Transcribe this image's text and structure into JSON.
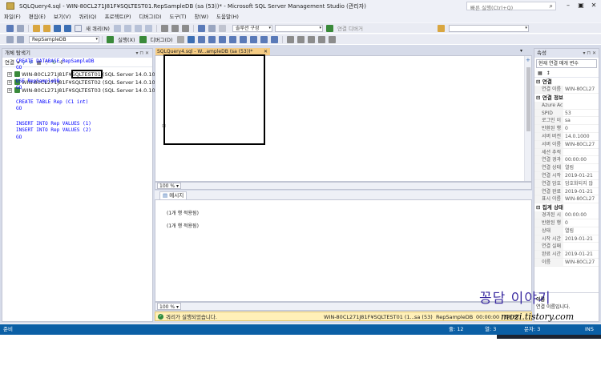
{
  "window": {
    "title": "SQLQuery4.sql - WIN-80CL271J81F¥SQLTEST01.RepSampleDB (sa (53))* - Microsoft SQL Server Management Studio (관리자)",
    "quick_launch_placeholder": "빠른 실행(Ctrl+Q)",
    "minimize": "–",
    "maximize": "▣",
    "close": "✕"
  },
  "menu": [
    "파일(F)",
    "편집(E)",
    "보기(V)",
    "쿼리(Q)",
    "프로젝트(P)",
    "디버그(D)",
    "도구(T)",
    "창(W)",
    "도움말(H)"
  ],
  "toolbar1": {
    "new_query": "새 쿼리(N)",
    "solution_configs": "솔루션 구성",
    "solution_platforms": "",
    "start_debug": "연결 디버거"
  },
  "toolbar2": {
    "database": "RepSampleDB",
    "execute": "실행(X)",
    "debug": "디버그(D)"
  },
  "object_explorer": {
    "title": "개체 탐색기",
    "connect": "연결",
    "servers": [
      {
        "name": "WIN-80CL271J81F¥SQLTEST01 (SQL Server 14.0.1000"
      },
      {
        "name": "WIN-80CL271J81F¥SQLTEST02 (SQL Server 14.0.1000"
      },
      {
        "name": "WIN-80CL271J81F¥SQLTEST03 (SQL Server 14.0.1000"
      }
    ]
  },
  "document": {
    "tab_label": "SQLQuery4.sql - W...ampleDB (sa (53))*",
    "code_lines": [
      "CREATE DATABASE RepSampleDB",
      "GO",
      "",
      "USE RepSampleDB",
      "GO",
      "",
      "CREATE TABLE Rep (C1 int)",
      "GO",
      "",
      "INSERT INTO Rep VALUES (1)",
      "INSERT INTO Rep VALUES (2)",
      "GO"
    ],
    "zoom": "100 %"
  },
  "results": {
    "tab_label": "메시지",
    "messages": [
      "(1개 행 적용됨)",
      "(1개 행 적용됨)"
    ],
    "zoom": "100 %"
  },
  "query_status": {
    "message": "쿼리가 실행되었습니다.",
    "server": "WIN-80CL271J81F¥SQLTEST01 (1...",
    "user": "sa (53)",
    "database": "RepSampleDB",
    "elapsed": "00:00:00",
    "rows": "0개 행"
  },
  "properties": {
    "title": "속성",
    "selector": "현재 연결 매개 변수",
    "groups": [
      {
        "name": "연결",
        "rows": [
          {
            "k": "연결 이름",
            "v": "WIN-80CL27"
          }
        ]
      },
      {
        "name": "연결 정보",
        "rows": [
          {
            "k": "Azure Ac",
            "v": ""
          },
          {
            "k": "SPID",
            "v": "53"
          },
          {
            "k": "로그인 이",
            "v": "sa"
          },
          {
            "k": "반환된 행",
            "v": "0"
          },
          {
            "k": "서버 버전",
            "v": "14.0.1000"
          },
          {
            "k": "서버 이름",
            "v": "WIN-80CL27"
          },
          {
            "k": "세션 추적",
            "v": ""
          },
          {
            "k": "연결 경과",
            "v": "00:00:00"
          },
          {
            "k": "연결 상태",
            "v": "열림"
          },
          {
            "k": "연결 시작",
            "v": "2019-01-21"
          },
          {
            "k": "연결 암호",
            "v": "암호화되지 않"
          },
          {
            "k": "연결 완료",
            "v": "2019-01-21"
          },
          {
            "k": "표시 이름",
            "v": "WIN-80CL27"
          }
        ]
      },
      {
        "name": "집계 상태",
        "rows": [
          {
            "k": "경과된 시",
            "v": "00:00:00"
          },
          {
            "k": "반환된 행",
            "v": "0"
          },
          {
            "k": "상태",
            "v": "열림"
          },
          {
            "k": "시작 시간",
            "v": "2019-01-21"
          },
          {
            "k": "연결 실패",
            "v": ""
          },
          {
            "k": "완료 시간",
            "v": "2019-01-21"
          },
          {
            "k": "이름",
            "v": "WIN-80CL27"
          }
        ]
      }
    ],
    "desc_title": "이름",
    "desc_text": "연결 이름입니다."
  },
  "watermark": {
    "title": "꽁담 이야기",
    "url": "mozi.tistory.com"
  },
  "statusbar": {
    "ready": "준비",
    "line": "줄: 12",
    "col": "열: 3",
    "ch": "문자: 3",
    "mode": "INS"
  }
}
